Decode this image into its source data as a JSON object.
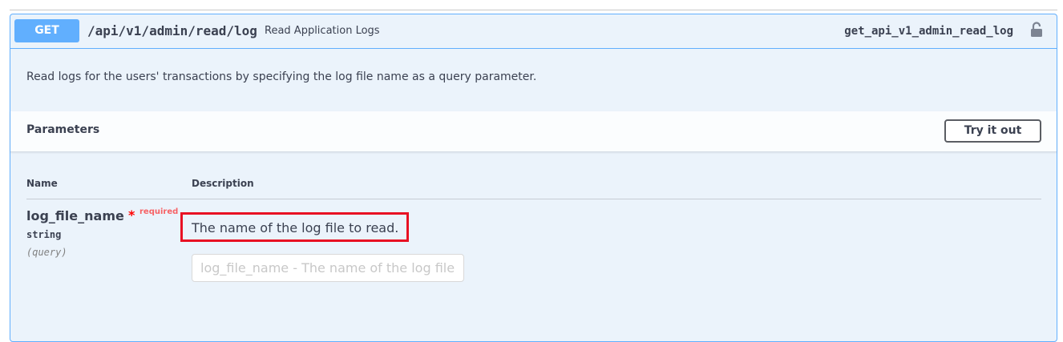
{
  "operation": {
    "method": "GET",
    "path": "/api/v1/admin/read/log",
    "summary": "Read Application Logs",
    "operation_id": "get_api_v1_admin_read_log",
    "lock_icon": "unlocked-padlock-icon",
    "description": "Read logs for the users' transactions by specifying the log file name as a query parameter."
  },
  "parameters_section": {
    "title": "Parameters",
    "try_button_label": "Try it out",
    "columns": {
      "name": "Name",
      "description": "Description"
    },
    "items": [
      {
        "name": "log_file_name",
        "required_mark": "*",
        "required_label": "required",
        "type": "string",
        "location": "(query)",
        "description": "The name of the log file to read.",
        "input_placeholder": "log_file_name - The name of the log file",
        "input_value": ""
      }
    ]
  },
  "colors": {
    "method_get": "#61affe",
    "panel_bg": "#ebf3fb",
    "required": "#ff0000",
    "highlight_box": "#e81123"
  }
}
